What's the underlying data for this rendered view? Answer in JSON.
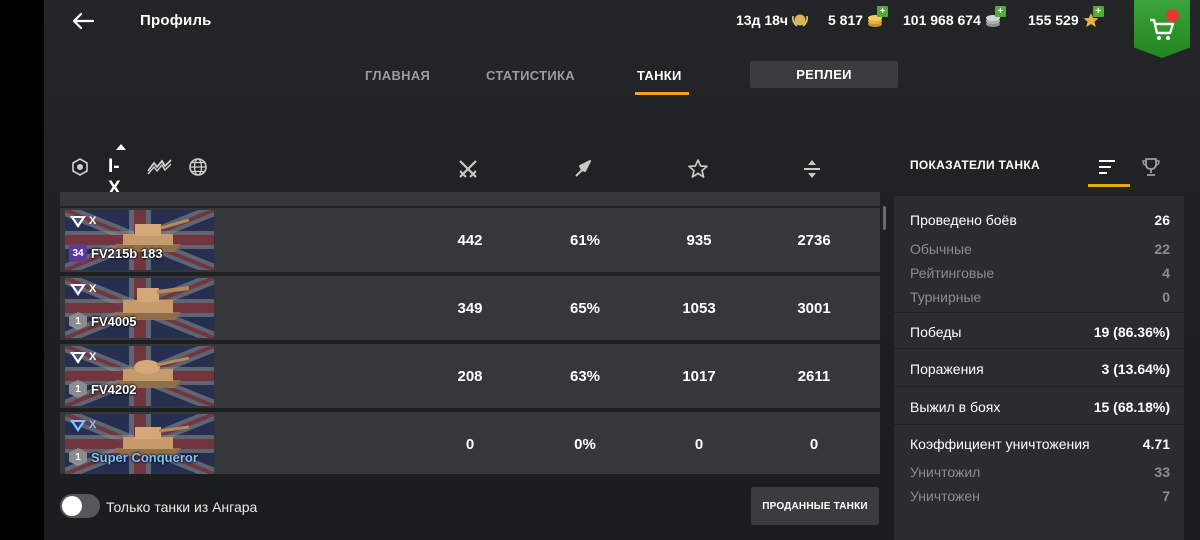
{
  "header": {
    "title": "Профиль",
    "premium_time": "13д 18ч",
    "gold": "5 817",
    "credits": "101 968 674",
    "free_xp": "155 529"
  },
  "tabs": {
    "main": "ГЛАВНАЯ",
    "stats": "СТАТИСТИКА",
    "tanks": "ТАНКИ",
    "replays": "РЕПЛЕИ"
  },
  "filters": {
    "tier": "I-X"
  },
  "rows": [
    {
      "name": "FV215b 183",
      "tier": "X",
      "mastery": "34",
      "battles": "442",
      "winrate": "61%",
      "xp": "935",
      "damage": "2736",
      "premium": false
    },
    {
      "name": "FV4005",
      "tier": "X",
      "mastery": "1",
      "battles": "349",
      "winrate": "65%",
      "xp": "1053",
      "damage": "3001",
      "premium": false
    },
    {
      "name": "FV4202",
      "tier": "X",
      "mastery": "1",
      "battles": "208",
      "winrate": "63%",
      "xp": "1017",
      "damage": "2611",
      "premium": false
    },
    {
      "name": "Super Conqueror",
      "tier": "X",
      "mastery": "1",
      "battles": "0",
      "winrate": "0%",
      "xp": "0",
      "damage": "0",
      "premium": true
    }
  ],
  "bottom": {
    "hangar_toggle_label": "Только танки из Ангара",
    "hangar_toggle_on": false,
    "sold_button": "ПРОДАННЫЕ ТАНКИ"
  },
  "panel": {
    "title": "ПОКАЗАТЕЛИ ТАНКА",
    "stats": [
      {
        "label": "Проведено боёв",
        "value": "26"
      },
      {
        "label": "Обычные",
        "value": "22"
      },
      {
        "label": "Рейтинговые",
        "value": "4"
      },
      {
        "label": "Турнирные",
        "value": "0"
      },
      {
        "label": "Победы",
        "value": "19 (86.36%)"
      },
      {
        "label": "Поражения",
        "value": "3 (13.64%)"
      },
      {
        "label": "Выжил в боях",
        "value": "15 (68.18%)"
      },
      {
        "label": "Коэффициент уничтожения",
        "value": "4.71"
      },
      {
        "label": "Уничтожил",
        "value": "33"
      },
      {
        "label": "Уничтожен",
        "value": "7"
      }
    ]
  },
  "colors": {
    "accent": "#f2a514",
    "plus": "#4caf2e",
    "shop": "#2e9a2a",
    "premium_name": "#7fc3ff"
  }
}
